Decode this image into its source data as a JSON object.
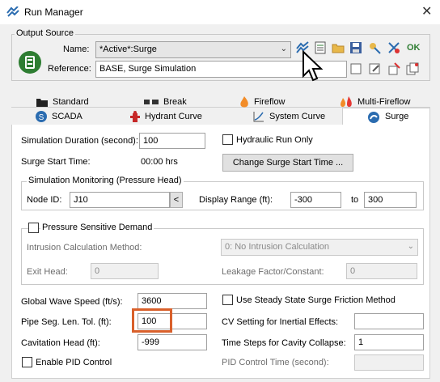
{
  "window": {
    "title": "Run Manager",
    "close_glyph": "✕"
  },
  "output_source": {
    "group_label": "Output Source",
    "name_label": "Name:",
    "name_value": "*Active*:Surge",
    "reference_label": "Reference:",
    "reference_value": "BASE, Surge Simulation",
    "ok_label": "OK"
  },
  "tabs": {
    "row1": [
      "Standard",
      "Break",
      "Fireflow",
      "Multi-Fireflow"
    ],
    "row2": [
      "SCADA",
      "Hydrant Curve",
      "System Curve",
      "Surge"
    ],
    "active": "Surge"
  },
  "surge": {
    "sim_duration_label": "Simulation Duration (second):",
    "sim_duration_value": "100",
    "hydraulic_run_only_label": "Hydraulic Run Only",
    "surge_start_label": "Surge Start Time:",
    "surge_start_value": "00:00 hrs",
    "change_surge_button": "Change Surge Start Time ...",
    "monitoring": {
      "group_label": "Simulation Monitoring (Pressure Head)",
      "node_id_label": "Node ID:",
      "node_id_value": "J10",
      "picker_glyph": "<",
      "display_range_label": "Display Range (ft):",
      "range_from": "-300",
      "to_label": "to",
      "range_to": "300"
    },
    "pressure_demand": {
      "checkbox_label": "Pressure Sensitive Demand",
      "intrusion_label": "Intrusion Calculation Method:",
      "intrusion_value": "0: No Intrusion Calculation",
      "exit_head_label": "Exit Head:",
      "exit_head_value": "0",
      "leakage_label": "Leakage Factor/Constant:",
      "leakage_value": "0"
    },
    "global_wave_speed_label": "Global Wave Speed (ft/s):",
    "global_wave_speed_value": "3600",
    "pipe_seg_label": "Pipe Seg. Len. Tol. (ft):",
    "pipe_seg_value": "100",
    "cavitation_label": "Cavitation Head (ft):",
    "cavitation_value": "-999",
    "enable_pid_label": "Enable PID Control",
    "steady_state_label": "Use Steady State Surge Friction Method",
    "cv_setting_label": "CV Setting for Inertial Effects:",
    "cv_setting_value": "",
    "time_steps_label": "Time Steps for Cavity Collapse:",
    "time_steps_value": "1",
    "pid_time_label": "PID Control Time (second):",
    "pid_time_value": ""
  },
  "colors": {
    "highlight": "#d9602b",
    "accent": "#2e7d32"
  }
}
